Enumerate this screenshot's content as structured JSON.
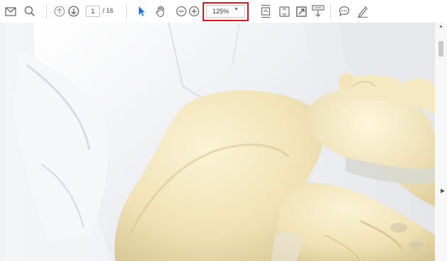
{
  "toolbar": {
    "page_current": "1",
    "page_total": "/ 16",
    "zoom_value": "125%",
    "zoom_caret": "▼",
    "icons": [
      "email-icon",
      "search-icon",
      "previous-page-icon",
      "next-page-icon",
      "select-cursor-icon",
      "hand-pan-icon",
      "zoom-out-icon",
      "zoom-in-icon",
      "fit-page-icon",
      "fit-width-icon",
      "fullscreen-icon",
      "download-icon",
      "comment-icon",
      "annotate-pen-icon"
    ]
  },
  "scrollbar": {
    "up_arrow": "▲",
    "side_arrow": "▶"
  },
  "colors": {
    "highlight": "#e0151b",
    "cursor_accent": "#1a73e8",
    "icon_gray": "#6b6b6b"
  }
}
